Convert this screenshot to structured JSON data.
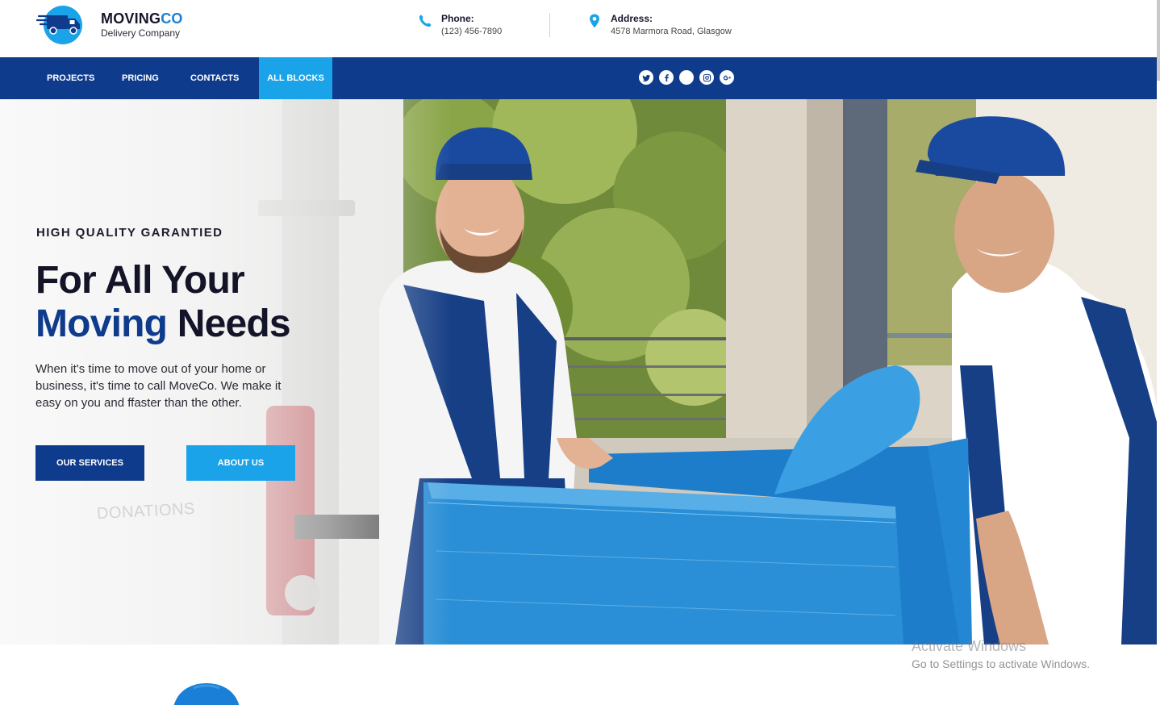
{
  "brand": {
    "name_part1": "MOVING",
    "name_part2": "CO",
    "tagline": "Delivery Company",
    "accent_color": "#1a7fd6"
  },
  "contacts": {
    "phone": {
      "label": "Phone:",
      "value": "(123) 456-7890",
      "icon": "phone-icon"
    },
    "address": {
      "label": "Address:",
      "value": "4578 Marmora Road, Glasgow",
      "icon": "map-pin-icon"
    }
  },
  "nav": {
    "items": [
      {
        "label": "PROJECTS",
        "active": false
      },
      {
        "label": "PRICING",
        "active": false
      },
      {
        "label": "CONTACTS",
        "active": false
      },
      {
        "label": "ALL BLOCKS",
        "active": true
      }
    ],
    "bar_color": "#0f3b8c",
    "active_color": "#1aa3e8"
  },
  "social": [
    "twitter-icon",
    "facebook-icon",
    "blank-circle-icon",
    "instagram-icon",
    "google-plus-icon"
  ],
  "hero": {
    "tag": "HIGH QUALITY GARANTIED",
    "title_line1": "For All Your",
    "title_line2_blue": "Moving",
    "title_line2_rest": "Needs",
    "description": "When it's time to move out of your home or business, it's time to call  MoveCo. We make it easy on you and ffaster than the other.",
    "button_primary": "OUR SERVICES",
    "button_secondary": "ABOUT US",
    "box_text": "DONATIONS"
  },
  "watermark": {
    "title": "Activate Windows",
    "subtitle": "Go to Settings to activate Windows."
  }
}
